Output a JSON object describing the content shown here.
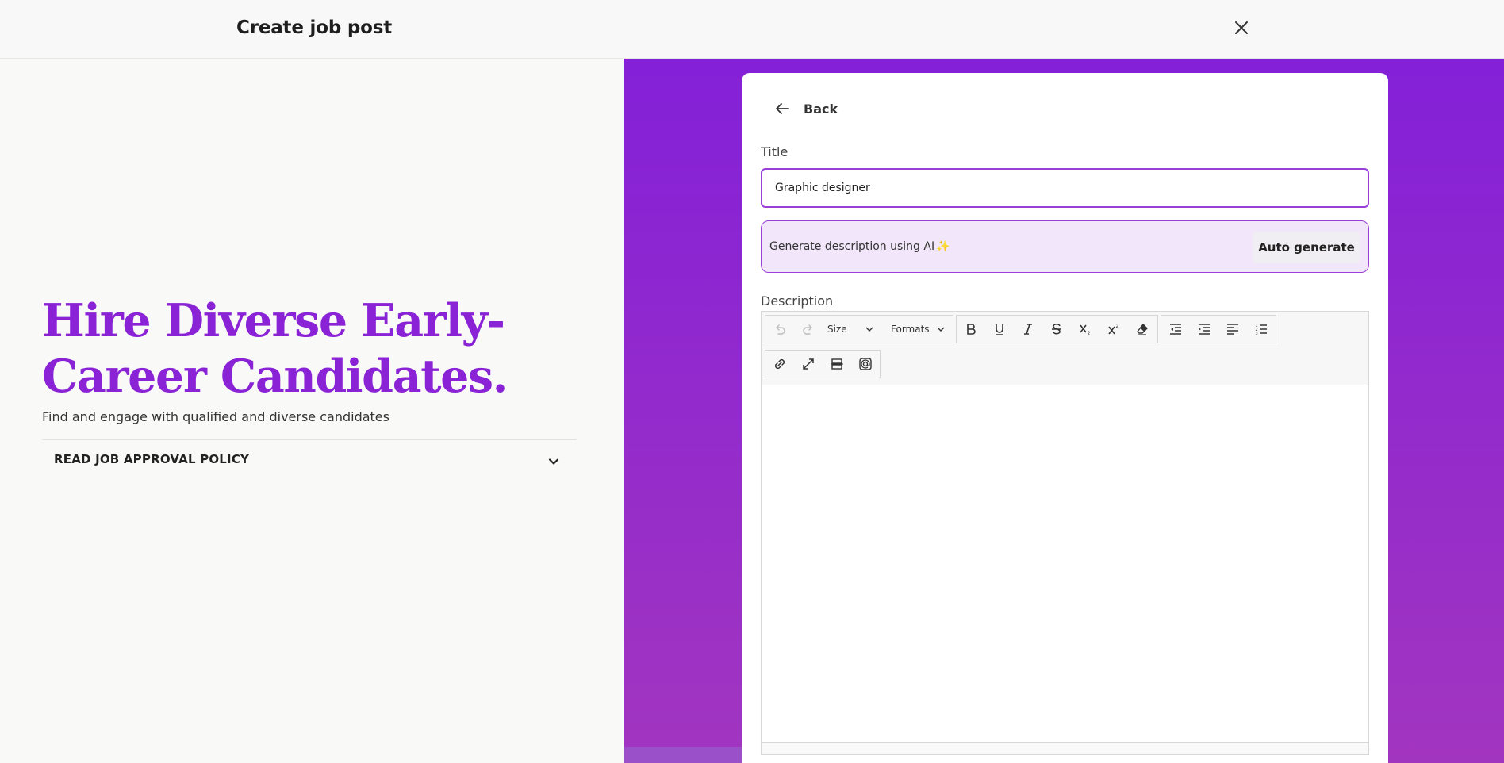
{
  "header": {
    "title": "Create job post"
  },
  "left": {
    "hero_title": "Hire Diverse Early-Career Candidates.",
    "hero_subtitle": "Find and engage with qualified and diverse candidates",
    "policy_label": "READ JOB APPROVAL POLICY"
  },
  "form": {
    "back_label": "Back",
    "title_label": "Title",
    "title_value": "Graphic designer",
    "ai_label": "Generate description using AI",
    "ai_sparkle": "✨",
    "auto_generate_label": "Auto generate",
    "description_label": "Description",
    "toolbar": {
      "size_label": "Size",
      "formats_label": "Formats"
    }
  },
  "colors": {
    "accent": "#8a22d6",
    "panel_gradient_top": "#8420d8",
    "panel_gradient_bottom": "#a235c0",
    "ai_box_bg": "#f1e6fa"
  }
}
